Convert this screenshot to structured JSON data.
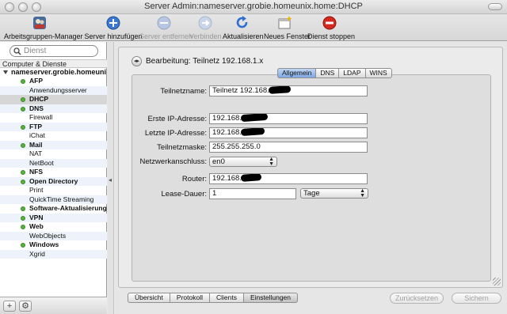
{
  "window": {
    "title": "Server Admin:nameserver.grobie.homeunix.home:DHCP"
  },
  "toolbar": {
    "workgroup_manager": "Arbeitsgruppen-Manager",
    "add_server": "Server hinzufügen",
    "remove_server": "Server entfernen",
    "connect": "Verbinden",
    "refresh": "Aktualisieren",
    "new_window": "Neues Fenster",
    "stop_service": "Dienst stoppen"
  },
  "sidebar": {
    "search_placeholder": "Dienst",
    "header": "Computer & Dienste",
    "server": "nameserver.grobie.homeuni",
    "services": [
      {
        "label": "AFP",
        "active": true
      },
      {
        "label": "Anwendungsserver",
        "active": false
      },
      {
        "label": "DHCP",
        "active": true,
        "selected": true
      },
      {
        "label": "DNS",
        "active": true
      },
      {
        "label": "Firewall",
        "active": false
      },
      {
        "label": "FTP",
        "active": true
      },
      {
        "label": "iChat",
        "active": false
      },
      {
        "label": "Mail",
        "active": true
      },
      {
        "label": "NAT",
        "active": false
      },
      {
        "label": "NetBoot",
        "active": false
      },
      {
        "label": "NFS",
        "active": true
      },
      {
        "label": "Open Directory",
        "active": true
      },
      {
        "label": "Print",
        "active": false
      },
      {
        "label": "QuickTime Streaming",
        "active": false
      },
      {
        "label": "Software-Aktualisierung",
        "active": true
      },
      {
        "label": "VPN",
        "active": true
      },
      {
        "label": "Web",
        "active": true
      },
      {
        "label": "WebObjects",
        "active": false
      },
      {
        "label": "Windows",
        "active": true
      },
      {
        "label": "Xgrid",
        "active": false
      }
    ],
    "add_btn": "+",
    "action_btn": "⚙",
    "status_colors": {
      "running": "#56b13d"
    }
  },
  "edit": {
    "heading": "Bearbeitung: Teilnetz 192.168.1.x",
    "tabs": [
      "Allgemein",
      "DNS",
      "LDAP",
      "WINS"
    ],
    "active_tab": "Allgemein"
  },
  "form": {
    "subnet_name_label": "Teilnetzname:",
    "subnet_name_value": "Teilnetz 192.168.",
    "start_ip_label": "Erste IP-Adresse:",
    "start_ip_value": "192.168.",
    "end_ip_label": "Letzte IP-Adresse:",
    "end_ip_value": "192.168.",
    "mask_label": "Teilnetzmaske:",
    "mask_value": "255.255.255.0",
    "interface_label": "Netzwerkanschluss:",
    "interface_value": "en0",
    "router_label": "Router:",
    "router_value": "192.168.",
    "lease_label": "Lease-Dauer:",
    "lease_value": "1",
    "lease_unit": "Tage"
  },
  "bottom": {
    "tabs": [
      "Übersicht",
      "Protokoll",
      "Clients",
      "Einstellungen"
    ],
    "active_tab": "Einstellungen",
    "revert": "Zurücksetzen",
    "save": "Sichern"
  }
}
